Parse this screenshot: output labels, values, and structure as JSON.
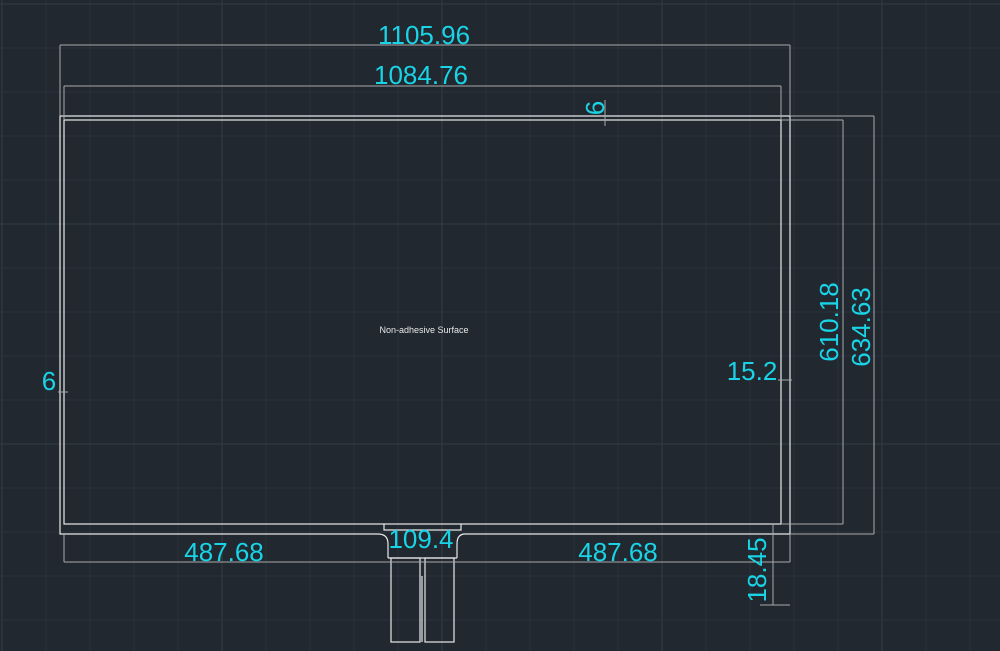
{
  "drawing": {
    "center_label": "Non-adhesive Surface",
    "colors": {
      "background": "#212830",
      "dimension_text": "#19d4e6",
      "outline": "#e8e8e8",
      "dimension_line": "#a9a9a9",
      "grid": "#2a323b"
    },
    "dimensions": {
      "overall_width": "1105.96",
      "inner_width": "1084.76",
      "top_margin": "6",
      "left_margin": "6",
      "right_margin": "15.2",
      "inner_height": "610.18",
      "overall_height": "634.63",
      "bottom_left_width": "487.68",
      "tail_width": "109.4",
      "bottom_right_width": "487.68",
      "bottom_margin": "18.45"
    }
  }
}
